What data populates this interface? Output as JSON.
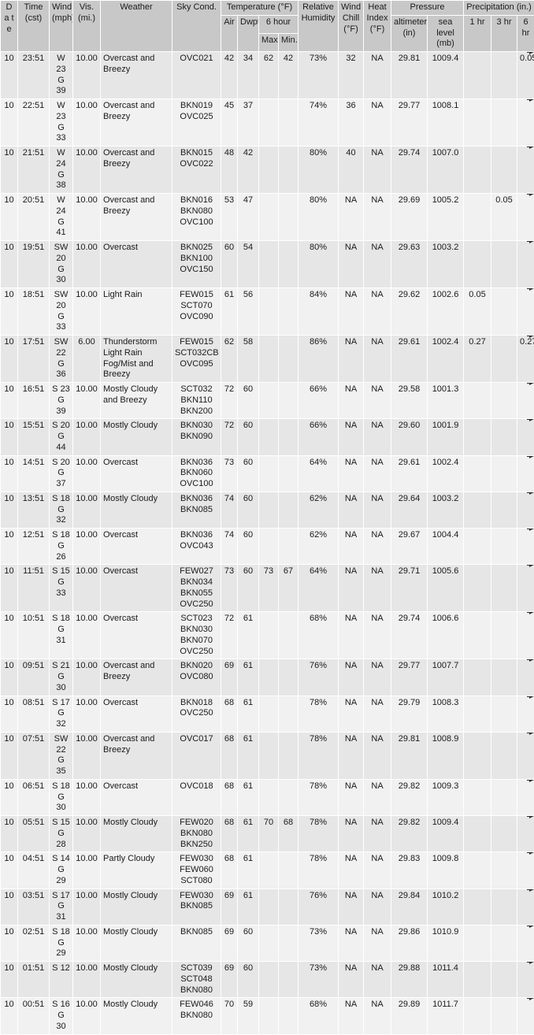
{
  "header": {
    "date": "D\na\nt\ne",
    "date_plain": "Date",
    "time": "Time",
    "time_unit": "(cst)",
    "wind": "Wind",
    "wind_unit": "(mph)",
    "vis": "Vis.",
    "vis_unit": "(mi.)",
    "weather": "Weather",
    "sky_cond": "Sky Cond.",
    "temperature_group": "Temperature (°F)",
    "air": "Air",
    "dwpt": "Dwpt",
    "six_hour": "6 hour",
    "max": "Max.",
    "min": "Min.",
    "relative_humidity": "Relative\nHumidity",
    "wind_chill": "Wind\nChill",
    "wind_chill_unit": "(°F)",
    "heat_index": "Heat\nIndex",
    "heat_index_unit": "(°F)",
    "pressure_group": "Pressure",
    "altimeter": "altimeter",
    "altimeter_unit": "(in)",
    "sea_level": "sea\nlevel",
    "sea_level_unit": "(mb)",
    "precipitation_group": "Precipitation (in.)",
    "p1hr": "1 hr",
    "p3hr": "3 hr",
    "p6hr": "6 hr"
  },
  "colors": {
    "header_bg": "#c8c8c8",
    "row_odd_bg": "#e6e6e6",
    "row_even_bg": "#f1f1f1",
    "grid": "#ffffff",
    "text": "#1a1a1a",
    "marker": "#2b2b2b"
  },
  "rows": [
    {
      "date": "10",
      "time": "23:51",
      "wind": "W 23\nG 39",
      "vis": "10.00",
      "weather": "Overcast and Breezy",
      "sky": "OVC021",
      "air": "42",
      "dwpt": "34",
      "max": "62",
      "min": "42",
      "rh": "73%",
      "wc": "32",
      "hi": "NA",
      "alt": "29.81",
      "slp": "1009.4",
      "p1": "",
      "p3": "",
      "p6": "0.05"
    },
    {
      "date": "10",
      "time": "22:51",
      "wind": "W 23\nG 33",
      "vis": "10.00",
      "weather": "Overcast and Breezy",
      "sky": "BKN019\nOVC025",
      "air": "45",
      "dwpt": "37",
      "max": "",
      "min": "",
      "rh": "74%",
      "wc": "36",
      "hi": "NA",
      "alt": "29.77",
      "slp": "1008.1",
      "p1": "",
      "p3": "",
      "p6": ""
    },
    {
      "date": "10",
      "time": "21:51",
      "wind": "W 24\nG 38",
      "vis": "10.00",
      "weather": "Overcast and Breezy",
      "sky": "BKN015\nOVC022",
      "air": "48",
      "dwpt": "42",
      "max": "",
      "min": "",
      "rh": "80%",
      "wc": "40",
      "hi": "NA",
      "alt": "29.74",
      "slp": "1007.0",
      "p1": "",
      "p3": "",
      "p6": ""
    },
    {
      "date": "10",
      "time": "20:51",
      "wind": "W 24\nG 41",
      "vis": "10.00",
      "weather": "Overcast and Breezy",
      "sky": "BKN016\nBKN080\nOVC100",
      "air": "53",
      "dwpt": "47",
      "max": "",
      "min": "",
      "rh": "80%",
      "wc": "NA",
      "hi": "NA",
      "alt": "29.69",
      "slp": "1005.2",
      "p1": "",
      "p3": "0.05",
      "p6": ""
    },
    {
      "date": "10",
      "time": "19:51",
      "wind": "SW 20 G 30",
      "vis": "10.00",
      "weather": "Overcast",
      "sky": "BKN025\nBKN100\nOVC150",
      "air": "60",
      "dwpt": "54",
      "max": "",
      "min": "",
      "rh": "80%",
      "wc": "NA",
      "hi": "NA",
      "alt": "29.63",
      "slp": "1003.2",
      "p1": "",
      "p3": "",
      "p6": ""
    },
    {
      "date": "10",
      "time": "18:51",
      "wind": "SW 20 G 33",
      "vis": "10.00",
      "weather": "Light Rain",
      "sky": "FEW015\nSCT070\nOVC090",
      "air": "61",
      "dwpt": "56",
      "max": "",
      "min": "",
      "rh": "84%",
      "wc": "NA",
      "hi": "NA",
      "alt": "29.62",
      "slp": "1002.6",
      "p1": "0.05",
      "p3": "",
      "p6": ""
    },
    {
      "date": "10",
      "time": "17:51",
      "wind": "SW 22 G 36",
      "vis": "6.00",
      "weather": "Thunderstorm Light Rain Fog/Mist and Breezy",
      "sky": "FEW015\nSCT032CB\nOVC095",
      "air": "62",
      "dwpt": "58",
      "max": "",
      "min": "",
      "rh": "86%",
      "wc": "NA",
      "hi": "NA",
      "alt": "29.61",
      "slp": "1002.4",
      "p1": "0.27",
      "p3": "",
      "p6": "0.27"
    },
    {
      "date": "10",
      "time": "16:51",
      "wind": "S 23\nG 39",
      "vis": "10.00",
      "weather": "Mostly Cloudy and Breezy",
      "sky": "SCT032\nBKN110\nBKN200",
      "air": "72",
      "dwpt": "60",
      "max": "",
      "min": "",
      "rh": "66%",
      "wc": "NA",
      "hi": "NA",
      "alt": "29.58",
      "slp": "1001.3",
      "p1": "",
      "p3": "",
      "p6": ""
    },
    {
      "date": "10",
      "time": "15:51",
      "wind": "S 20\nG 44",
      "vis": "10.00",
      "weather": "Mostly Cloudy",
      "sky": "BKN030\nBKN090",
      "air": "72",
      "dwpt": "60",
      "max": "",
      "min": "",
      "rh": "66%",
      "wc": "NA",
      "hi": "NA",
      "alt": "29.60",
      "slp": "1001.9",
      "p1": "",
      "p3": "",
      "p6": ""
    },
    {
      "date": "10",
      "time": "14:51",
      "wind": "S 20\nG 37",
      "vis": "10.00",
      "weather": "Overcast",
      "sky": "BKN036\nBKN060\nOVC100",
      "air": "73",
      "dwpt": "60",
      "max": "",
      "min": "",
      "rh": "64%",
      "wc": "NA",
      "hi": "NA",
      "alt": "29.61",
      "slp": "1002.4",
      "p1": "",
      "p3": "",
      "p6": ""
    },
    {
      "date": "10",
      "time": "13:51",
      "wind": "S 18\nG 32",
      "vis": "10.00",
      "weather": "Mostly Cloudy",
      "sky": "BKN036\nBKN085",
      "air": "74",
      "dwpt": "60",
      "max": "",
      "min": "",
      "rh": "62%",
      "wc": "NA",
      "hi": "NA",
      "alt": "29.64",
      "slp": "1003.2",
      "p1": "",
      "p3": "",
      "p6": ""
    },
    {
      "date": "10",
      "time": "12:51",
      "wind": "S 18\nG 26",
      "vis": "10.00",
      "weather": "Overcast",
      "sky": "BKN036\nOVC043",
      "air": "74",
      "dwpt": "60",
      "max": "",
      "min": "",
      "rh": "62%",
      "wc": "NA",
      "hi": "NA",
      "alt": "29.67",
      "slp": "1004.4",
      "p1": "",
      "p3": "",
      "p6": ""
    },
    {
      "date": "10",
      "time": "11:51",
      "wind": "S 15\nG 33",
      "vis": "10.00",
      "weather": "Overcast",
      "sky": "FEW027\nBKN034\nBKN055\nOVC250",
      "air": "73",
      "dwpt": "60",
      "max": "73",
      "min": "67",
      "rh": "64%",
      "wc": "NA",
      "hi": "NA",
      "alt": "29.71",
      "slp": "1005.6",
      "p1": "",
      "p3": "",
      "p6": ""
    },
    {
      "date": "10",
      "time": "10:51",
      "wind": "S 18\nG 31",
      "vis": "10.00",
      "weather": "Overcast",
      "sky": "SCT023\nBKN030\nBKN070\nOVC250",
      "air": "72",
      "dwpt": "61",
      "max": "",
      "min": "",
      "rh": "68%",
      "wc": "NA",
      "hi": "NA",
      "alt": "29.74",
      "slp": "1006.6",
      "p1": "",
      "p3": "",
      "p6": ""
    },
    {
      "date": "10",
      "time": "09:51",
      "wind": "S 21\nG 30",
      "vis": "10.00",
      "weather": "Overcast and Breezy",
      "sky": "BKN020\nOVC080",
      "air": "69",
      "dwpt": "61",
      "max": "",
      "min": "",
      "rh": "76%",
      "wc": "NA",
      "hi": "NA",
      "alt": "29.77",
      "slp": "1007.7",
      "p1": "",
      "p3": "",
      "p6": ""
    },
    {
      "date": "10",
      "time": "08:51",
      "wind": "S 17\nG 32",
      "vis": "10.00",
      "weather": "Overcast",
      "sky": "BKN018\nOVC250",
      "air": "68",
      "dwpt": "61",
      "max": "",
      "min": "",
      "rh": "78%",
      "wc": "NA",
      "hi": "NA",
      "alt": "29.79",
      "slp": "1008.3",
      "p1": "",
      "p3": "",
      "p6": ""
    },
    {
      "date": "10",
      "time": "07:51",
      "wind": "SW 22 G 35",
      "vis": "10.00",
      "weather": "Overcast and Breezy",
      "sky": "OVC017",
      "air": "68",
      "dwpt": "61",
      "max": "",
      "min": "",
      "rh": "78%",
      "wc": "NA",
      "hi": "NA",
      "alt": "29.81",
      "slp": "1008.9",
      "p1": "",
      "p3": "",
      "p6": ""
    },
    {
      "date": "10",
      "time": "06:51",
      "wind": "S 18\nG 30",
      "vis": "10.00",
      "weather": "Overcast",
      "sky": "OVC018",
      "air": "68",
      "dwpt": "61",
      "max": "",
      "min": "",
      "rh": "78%",
      "wc": "NA",
      "hi": "NA",
      "alt": "29.82",
      "slp": "1009.3",
      "p1": "",
      "p3": "",
      "p6": ""
    },
    {
      "date": "10",
      "time": "05:51",
      "wind": "S 15\nG 28",
      "vis": "10.00",
      "weather": "Mostly Cloudy",
      "sky": "FEW020\nBKN080\nBKN250",
      "air": "68",
      "dwpt": "61",
      "max": "70",
      "min": "68",
      "rh": "78%",
      "wc": "NA",
      "hi": "NA",
      "alt": "29.82",
      "slp": "1009.4",
      "p1": "",
      "p3": "",
      "p6": ""
    },
    {
      "date": "10",
      "time": "04:51",
      "wind": "S 14\nG 29",
      "vis": "10.00",
      "weather": "Partly Cloudy",
      "sky": "FEW030\nFEW060\nSCT080",
      "air": "68",
      "dwpt": "61",
      "max": "",
      "min": "",
      "rh": "78%",
      "wc": "NA",
      "hi": "NA",
      "alt": "29.83",
      "slp": "1009.8",
      "p1": "",
      "p3": "",
      "p6": ""
    },
    {
      "date": "10",
      "time": "03:51",
      "wind": "S 17\nG 31",
      "vis": "10.00",
      "weather": "Mostly Cloudy",
      "sky": "FEW030\nBKN085",
      "air": "69",
      "dwpt": "61",
      "max": "",
      "min": "",
      "rh": "76%",
      "wc": "NA",
      "hi": "NA",
      "alt": "29.84",
      "slp": "1010.2",
      "p1": "",
      "p3": "",
      "p6": ""
    },
    {
      "date": "10",
      "time": "02:51",
      "wind": "S 18\nG 29",
      "vis": "10.00",
      "weather": "Mostly Cloudy",
      "sky": "BKN085",
      "air": "69",
      "dwpt": "60",
      "max": "",
      "min": "",
      "rh": "73%",
      "wc": "NA",
      "hi": "NA",
      "alt": "29.86",
      "slp": "1010.9",
      "p1": "",
      "p3": "",
      "p6": ""
    },
    {
      "date": "10",
      "time": "01:51",
      "wind": "S 12",
      "vis": "10.00",
      "weather": "Mostly Cloudy",
      "sky": "SCT039\nSCT048\nBKN080",
      "air": "69",
      "dwpt": "60",
      "max": "",
      "min": "",
      "rh": "73%",
      "wc": "NA",
      "hi": "NA",
      "alt": "29.88",
      "slp": "1011.4",
      "p1": "",
      "p3": "",
      "p6": ""
    },
    {
      "date": "10",
      "time": "00:51",
      "wind": "S 16\nG 30",
      "vis": "10.00",
      "weather": "Mostly Cloudy",
      "sky": "FEW046\nBKN080",
      "air": "70",
      "dwpt": "59",
      "max": "",
      "min": "",
      "rh": "68%",
      "wc": "NA",
      "hi": "NA",
      "alt": "29.89",
      "slp": "1011.7",
      "p1": "",
      "p3": "",
      "p6": ""
    }
  ]
}
